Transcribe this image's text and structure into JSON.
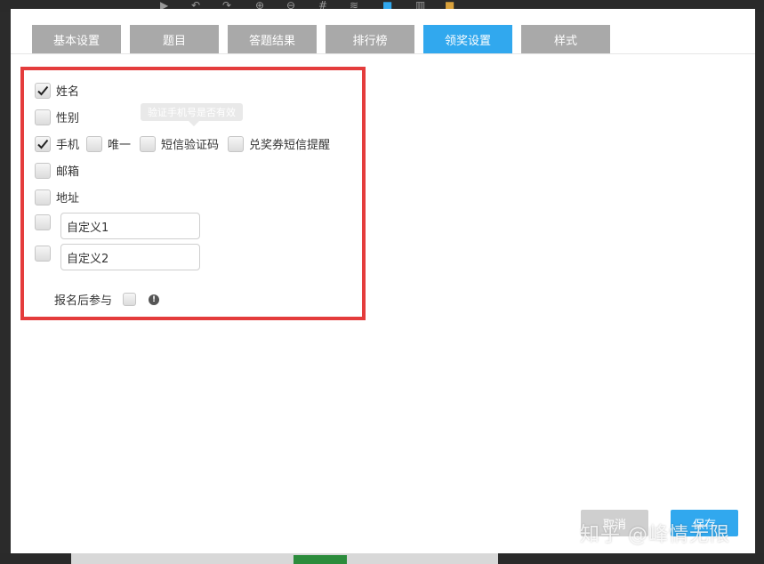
{
  "tabs": [
    {
      "label": "基本设置",
      "active": false
    },
    {
      "label": "题目",
      "active": false
    },
    {
      "label": "答题结果",
      "active": false
    },
    {
      "label": "排行榜",
      "active": false
    },
    {
      "label": "领奖设置",
      "active": true
    },
    {
      "label": "样式",
      "active": false
    }
  ],
  "fields": {
    "name": {
      "label": "姓名",
      "checked": true
    },
    "gender": {
      "label": "性别",
      "checked": false
    },
    "phone": {
      "label": "手机",
      "checked": true,
      "tooltip": "验证手机号是否有效",
      "options": [
        {
          "label": "唯一",
          "checked": false
        },
        {
          "label": "短信验证码",
          "checked": false
        },
        {
          "label": "兑奖券短信提醒",
          "checked": false
        }
      ]
    },
    "email": {
      "label": "邮箱",
      "checked": false
    },
    "address": {
      "label": "地址",
      "checked": false
    },
    "custom1": {
      "value": "自定义1",
      "checked": false
    },
    "custom2": {
      "value": "自定义2",
      "checked": false
    }
  },
  "after_signup": {
    "label": "报名后参与",
    "checked": false
  },
  "buttons": {
    "cancel": "取消",
    "save": "保存"
  },
  "watermark": "知乎 @峰情无限",
  "colors": {
    "accent": "#31a8ee",
    "tab_inactive": "#a9a9a9",
    "highlight_border": "#e43c3c"
  }
}
